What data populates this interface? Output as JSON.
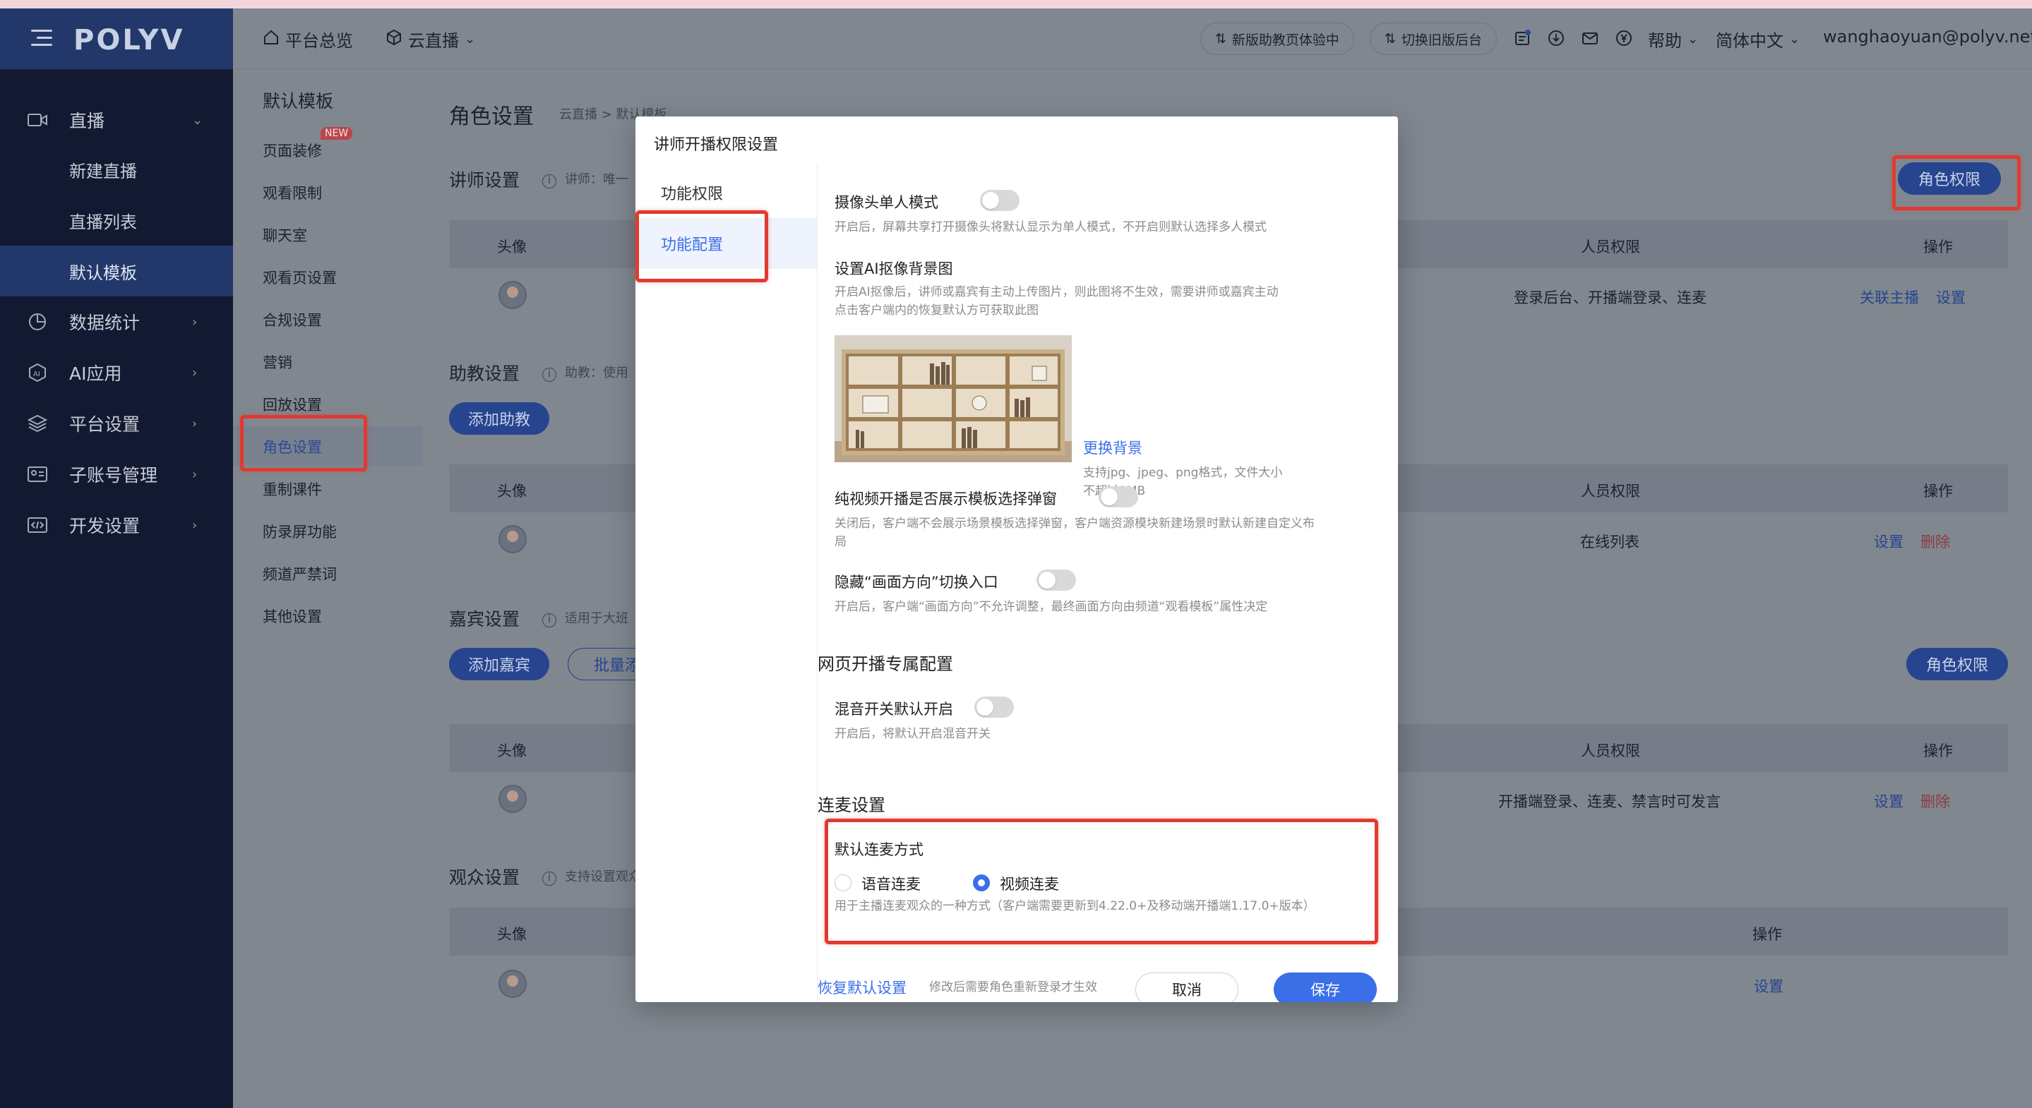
{
  "brand": {
    "logo": "POLYV"
  },
  "sidebar": {
    "items": [
      {
        "label": "直播",
        "icon": "video-icon",
        "chevron": "⌄"
      },
      {
        "label": "数据统计",
        "icon": "chart-pie-icon",
        "chevron": "›"
      },
      {
        "label": "AI应用",
        "icon": "ai-icon",
        "chevron": "›"
      },
      {
        "label": "平台设置",
        "icon": "layers-icon",
        "chevron": "›"
      },
      {
        "label": "子账号管理",
        "icon": "id-card-icon",
        "chevron": "›"
      },
      {
        "label": "开发设置",
        "icon": "code-icon",
        "chevron": "›"
      }
    ],
    "sub_items": [
      "新建直播",
      "直播列表",
      "默认模板"
    ]
  },
  "header": {
    "overview": "平台总览",
    "cloud_live": "云直播",
    "new_assistant_pill": "新版助教页体验中",
    "switch_old_pill": "切换旧版后台",
    "help": "帮助",
    "language": "简体中文",
    "account": "wanghaoyuan@polyv.net"
  },
  "subnav": {
    "title": "默认模板",
    "new_badge": "NEW",
    "items": [
      "页面装修",
      "观看限制",
      "聊天室",
      "观看页设置",
      "合规设置",
      "营销",
      "回放设置",
      "角色设置",
      "重制课件",
      "防录屏功能",
      "频道严禁词",
      "其他设置"
    ]
  },
  "main": {
    "title": "角色设置",
    "breadcrumb": "云直播 > 默认模板",
    "role_perm_btn": "角色权限",
    "teacher": {
      "title": "讲师设置",
      "hint": "讲师：唯一",
      "cols": {
        "avatar": "头像",
        "perm": "人员权限",
        "ops": "操作"
      },
      "row_perm": "登录后台、开播端登录、连麦",
      "link1": "关联主播",
      "link2": "设置"
    },
    "assistant": {
      "title": "助教设置",
      "hint": "助教：使用",
      "add_btn": "添加助教",
      "cols": {
        "avatar": "头像",
        "perm": "人员权限",
        "ops": "操作"
      },
      "row_perm": "在线列表",
      "link1": "设置",
      "del": "删除"
    },
    "guest": {
      "title": "嘉宾设置",
      "hint": "适用于大班",
      "add_btn": "添加嘉宾",
      "batch_btn": "批量添",
      "role_btn": "角色权限",
      "cols": {
        "avatar": "头像",
        "perm": "人员权限",
        "ops": "操作"
      },
      "row_perm": "开播端登录、连麦、禁言时可发言",
      "link1": "设置",
      "del": "删除"
    },
    "audience": {
      "title": "观众设置",
      "hint": "支持设置观众",
      "cols": {
        "avatar": "头像",
        "ops": "操作"
      },
      "link1": "设置"
    }
  },
  "modal": {
    "title": "讲师开播权限设置",
    "tabs": [
      "功能权限",
      "功能配置"
    ],
    "camera_single": {
      "label": "摄像头单人模式",
      "desc": "开启后，屏幕共享打开摄像头将默认显示为单人模式，不开启则默认选择多人模式",
      "enabled": false
    },
    "ai_bg": {
      "label": "设置AI抠像背景图",
      "desc1": "开启AI抠像后，讲师或嘉宾有主动上传图片，则此图将不生效，需要讲师或嘉宾主动",
      "desc2": "点击客户端内的恢复默认方可获取此图",
      "change_link": "更换背景",
      "format1": "支持jpg、jpeg、png格式，文件大小",
      "format2": "不超过2MB"
    },
    "template_popup": {
      "label": "纯视频开播是否展示模板选择弹窗",
      "desc1": "关闭后，客户端不会展示场景模板选择弹窗，客户端资源模块新建场景时默认新建自定义布",
      "desc2": "局",
      "enabled": false
    },
    "hide_orientation": {
      "label": "隐藏“画面方向”切换入口",
      "desc": "开启后，客户端“画面方向”不允许调整，最终画面方向由频道“观看模板”属性决定",
      "enabled": false
    },
    "web_section": "网页开播专属配置",
    "mix_audio": {
      "label": "混音开关默认开启",
      "desc": "开启后，将默认开启混音开关",
      "enabled": false
    },
    "link_section": "连麦设置",
    "link_mode": {
      "label": "默认连麦方式",
      "options": [
        "语音连麦",
        "视频连麦"
      ],
      "selected": "视频连麦",
      "desc": "用于主播连麦观众的一种方式（客户端需要更新到4.22.0+及移动端开播端1.17.0+版本）"
    },
    "footer": {
      "restore": "恢复默认设置",
      "note": "修改后需要角色重新登录才生效",
      "cancel": "取消",
      "save": "保存"
    }
  },
  "colors": {
    "accent": "#3b6fe8",
    "highlight": "#e03a30",
    "sidebar": "#121a32"
  }
}
